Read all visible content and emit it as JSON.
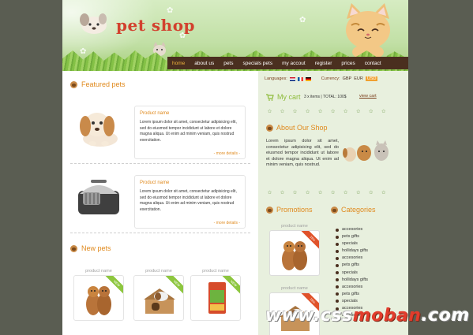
{
  "header": {
    "logo": "pet shop"
  },
  "nav": {
    "items": [
      "home",
      "about us",
      "pets",
      "specials pets",
      "my accout",
      "register",
      "prices",
      "contact"
    ],
    "active": "home"
  },
  "featured": {
    "title": "Featured pets",
    "items": [
      {
        "name": "Product name",
        "desc": "Lorem ipsum dolor sit amet, consectetur adipisicing elit, sed do eiusmod tempor incididunt ut labore et dolore magna aliqua. Ut enim ad minim veniam, quis nostrud exercitation.",
        "more": "- more details -"
      },
      {
        "name": "Product name",
        "desc": "Lorem ipsum dolor sit amet, consectetur adipisicing elit, sed do eiusmod tempor incididunt ut labore et dolore magna aliqua. Ut enim ad minim veniam, quis nostrud exercitation.",
        "more": "- more details -"
      }
    ]
  },
  "new_pets": {
    "title": "New pets",
    "items": [
      {
        "name": "product name",
        "badge": "NEW"
      },
      {
        "name": "product name",
        "badge": "NEW"
      },
      {
        "name": "product name",
        "badge": "NEW"
      }
    ]
  },
  "sidebar": {
    "languages_label": "Languages:",
    "currency_label": "Currency:",
    "currencies": [
      "GBP",
      "EUR",
      "USD"
    ],
    "selected_currency": "USD",
    "cart_title": "My cart",
    "cart_info": "3 x items | TOTAL: 100$",
    "cart_link": "view cart",
    "about_title": "About Our Shop",
    "about_text": "Lorem ipsum dolor sit amet, consectetur adipisicing elit, sed do eiusmod tempor incididunt ut labore et dolore magna aliqua. Ut enim ad minim veniam, quis nostrud.",
    "promotions_title": "Promotions",
    "promotions": [
      {
        "name": "product name",
        "badge": "15%"
      },
      {
        "name": "product name",
        "badge": "15%"
      }
    ],
    "categories_title": "Categories",
    "categories": [
      "accesories",
      "pets gifts",
      "specials",
      "hollidays gifts",
      "accesories",
      "pets gifts",
      "specials",
      "hollidays gifts",
      "accesories",
      "pets gifts",
      "specials",
      "accesories",
      "accesories"
    ]
  },
  "watermark": {
    "left": "www.css",
    "mid": "moban",
    "right": ".com"
  },
  "colors": {
    "background": "#5a5d52",
    "header": "#c2e0a6",
    "nav": "#4a2f1f",
    "accent_orange": "#e08a1e",
    "sidebar": "#e8f0de",
    "cart_green": "#8dbb3a"
  }
}
